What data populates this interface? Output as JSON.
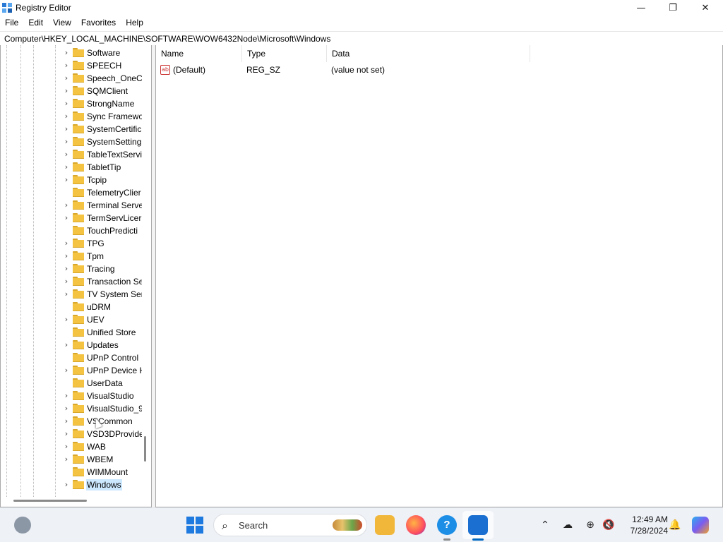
{
  "window": {
    "title": "Registry Editor",
    "controls": {
      "minimize": "—",
      "maximize": "❐",
      "close": "✕"
    }
  },
  "menu": [
    "File",
    "Edit",
    "View",
    "Favorites",
    "Help"
  ],
  "address": "Computer\\HKEY_LOCAL_MACHINE\\SOFTWARE\\WOW6432Node\\Microsoft\\Windows",
  "tree": {
    "items": [
      {
        "label": "Software",
        "expandable": true
      },
      {
        "label": "SPEECH",
        "expandable": true
      },
      {
        "label": "Speech_OneCo",
        "expandable": true
      },
      {
        "label": "SQMClient",
        "expandable": true
      },
      {
        "label": "StrongName",
        "expandable": true
      },
      {
        "label": "Sync Framewo",
        "expandable": true
      },
      {
        "label": "SystemCertific",
        "expandable": true
      },
      {
        "label": "SystemSetting",
        "expandable": true
      },
      {
        "label": "TableTextServi",
        "expandable": true
      },
      {
        "label": "TabletTip",
        "expandable": true
      },
      {
        "label": "Tcpip",
        "expandable": true
      },
      {
        "label": "TelemetryClier",
        "expandable": false
      },
      {
        "label": "Terminal Serve",
        "expandable": true
      },
      {
        "label": "TermServLicer",
        "expandable": true
      },
      {
        "label": "TouchPredicti",
        "expandable": false
      },
      {
        "label": "TPG",
        "expandable": true
      },
      {
        "label": "Tpm",
        "expandable": true
      },
      {
        "label": "Tracing",
        "expandable": true
      },
      {
        "label": "Transaction Se",
        "expandable": true
      },
      {
        "label": "TV System Ser",
        "expandable": true
      },
      {
        "label": "uDRM",
        "expandable": false
      },
      {
        "label": "UEV",
        "expandable": true
      },
      {
        "label": "Unified Store",
        "expandable": false
      },
      {
        "label": "Updates",
        "expandable": true
      },
      {
        "label": "UPnP Control",
        "expandable": false
      },
      {
        "label": "UPnP Device H",
        "expandable": true
      },
      {
        "label": "UserData",
        "expandable": false
      },
      {
        "label": "VisualStudio",
        "expandable": true
      },
      {
        "label": "VisualStudio_9",
        "expandable": true
      },
      {
        "label": "VSCommon",
        "expandable": true
      },
      {
        "label": "VSD3DProvide",
        "expandable": true
      },
      {
        "label": "WAB",
        "expandable": true
      },
      {
        "label": "WBEM",
        "expandable": true
      },
      {
        "label": "WIMMount",
        "expandable": false
      },
      {
        "label": "Windows",
        "expandable": true,
        "selected": true
      }
    ]
  },
  "values": {
    "headers": {
      "name": "Name",
      "type": "Type",
      "data": "Data"
    },
    "rows": [
      {
        "icon": "string-value-icon",
        "icon_text": "ab",
        "name": "(Default)",
        "type": "REG_SZ",
        "data": "(value not set)"
      }
    ]
  },
  "taskbar": {
    "search_label": "Search",
    "help_glyph": "?",
    "clock_time": "12:49 AM",
    "clock_date": "7/28/2024",
    "tray": {
      "chevron": "⌃",
      "onedrive": "☁",
      "network": "⊕",
      "volume": "🔇",
      "bell": "🔔"
    }
  },
  "colors": {
    "selection": "#cce8ff",
    "folder": "#f5c342",
    "accent": "#0067c0"
  }
}
